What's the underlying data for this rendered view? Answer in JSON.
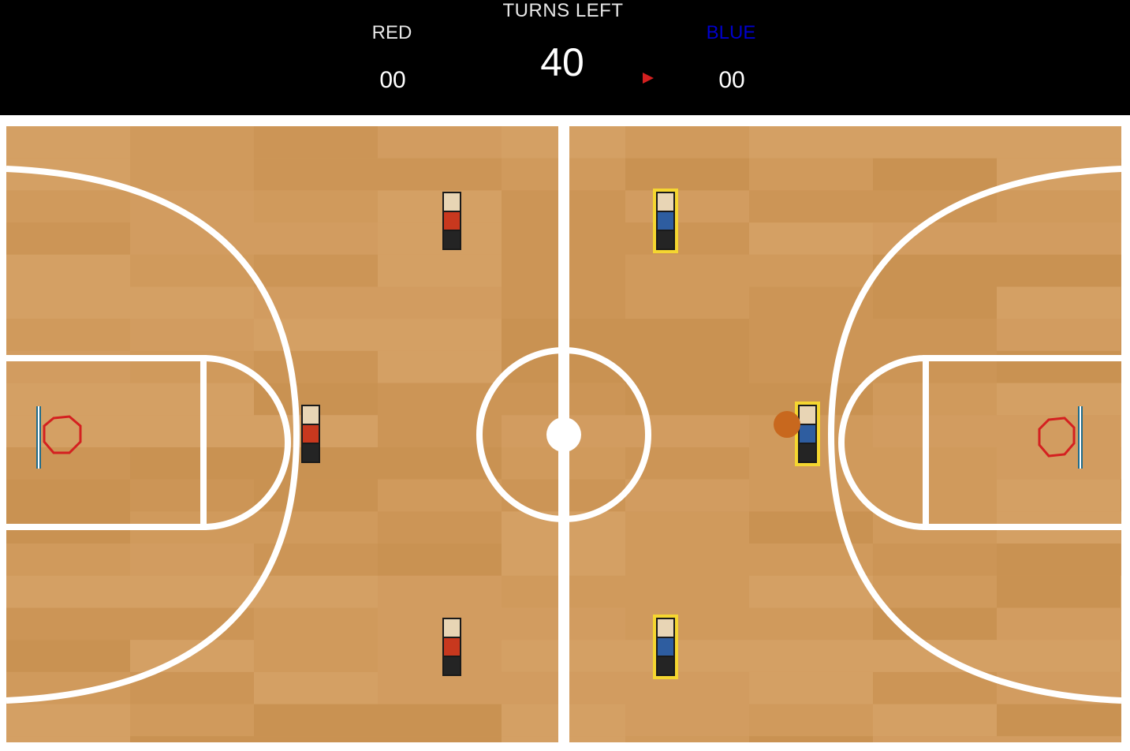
{
  "scoreboard": {
    "turns_label": "TURNS LEFT",
    "turns_left": "40",
    "red": {
      "label": "RED",
      "score": "00",
      "color": "#e8e8e8"
    },
    "blue": {
      "label": "BLUE",
      "score": "00",
      "color": "#0000cc"
    },
    "turn_indicator_color": "#d42020"
  },
  "court": {
    "floor_color": "#d09a5c",
    "line_color": "#ffffff",
    "rim_color": "#d42020",
    "backboard_color": "#1e6b8a"
  },
  "players": {
    "red": [
      {
        "id": "red-player-top"
      },
      {
        "id": "red-player-mid"
      },
      {
        "id": "red-player-bottom"
      }
    ],
    "blue": [
      {
        "id": "blue-player-top",
        "selected": true
      },
      {
        "id": "blue-player-mid",
        "selected": true,
        "has_ball": true
      },
      {
        "id": "blue-player-bottom",
        "selected": true
      }
    ]
  },
  "ball": {
    "color": "#c8681e"
  }
}
